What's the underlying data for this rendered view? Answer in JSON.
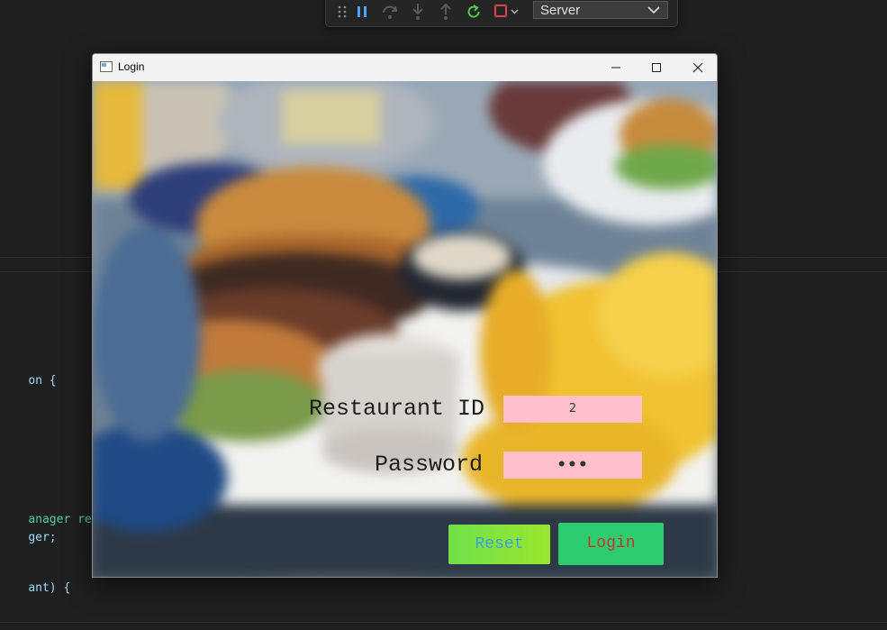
{
  "editor": {
    "lines": [
      {
        "text": "on {"
      },
      {
        "text": "anager restau"
      },
      {
        "text": "ger;"
      },
      {
        "text": "ant) {"
      }
    ]
  },
  "debug_toolbar": {
    "icons": [
      "drag-handle-icon",
      "pause-icon",
      "step-over-icon",
      "step-into-icon",
      "step-out-icon",
      "restart-icon",
      "stop-icon"
    ],
    "target_select": "Server",
    "colors": {
      "pause": "#4fa3ff",
      "restart": "#4ec94e",
      "stop": "#f14c4c"
    }
  },
  "window": {
    "title": "Login",
    "form": {
      "restaurant_id_label": "Restaurant ID",
      "restaurant_id_value": "2",
      "password_label": "Password",
      "password_value": "•••",
      "reset_label": "Reset",
      "login_label": "Login"
    },
    "colors": {
      "field_bg": "#ffc0cb",
      "reset_bg": "#7be03a",
      "reset_text": "#3d9fd8",
      "login_bg": "#2ecc71",
      "login_text": "#c0392b"
    }
  }
}
